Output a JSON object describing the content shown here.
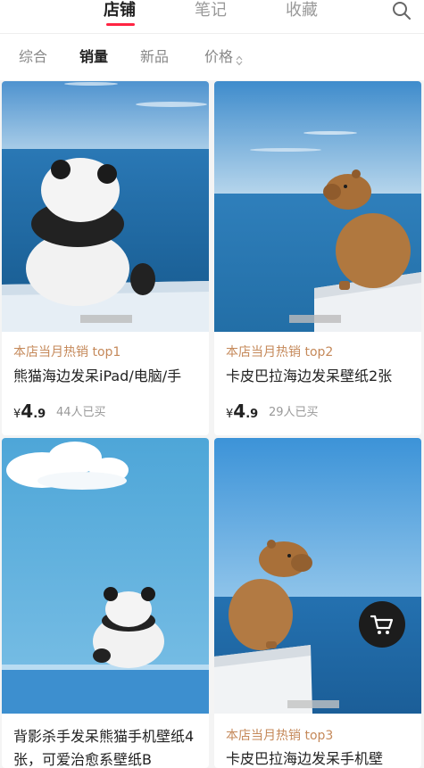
{
  "top_tabs": [
    {
      "label": "店铺",
      "active": true
    },
    {
      "label": "笔记",
      "active": false
    },
    {
      "label": "收藏",
      "active": false
    }
  ],
  "icons": {
    "search": "search-icon",
    "cart": "shopping-cart-icon",
    "sort": "sort-arrows-icon"
  },
  "sort_tabs": [
    {
      "label": "综合",
      "active": false
    },
    {
      "label": "销量",
      "active": true
    },
    {
      "label": "新品",
      "active": false
    },
    {
      "label": "价格",
      "active": false
    }
  ],
  "products": [
    {
      "rank": "本店当月热销 top1",
      "title": "熊猫海边发呆iPad/电脑/手",
      "price_symbol": "¥",
      "price_int": "4",
      "price_dec": ".9",
      "sold": "44人已买"
    },
    {
      "rank": "本店当月热销 top2",
      "title": "卡皮巴拉海边发呆壁纸2张",
      "price_symbol": "¥",
      "price_int": "4",
      "price_dec": ".9",
      "sold": "29人已买"
    },
    {
      "rank": "",
      "title": "背影杀手发呆熊猫手机壁纸4张，可爱治愈系壁纸B",
      "price_symbol": "",
      "price_int": "",
      "price_dec": "",
      "sold": ""
    },
    {
      "rank": "本店当月热销 top3",
      "title": "卡皮巴拉海边发呆手机壁",
      "price_symbol": "",
      "price_int": "",
      "price_dec": "",
      "sold": ""
    }
  ],
  "colors": {
    "accent": "#ff2442",
    "rank": "#c5895a",
    "sky": "#4a9ad8",
    "sea": "#1f6fa6"
  }
}
